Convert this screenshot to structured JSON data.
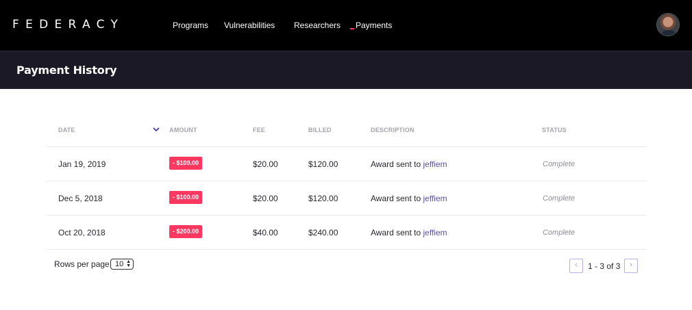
{
  "brand": {
    "logo": "FEDERACY"
  },
  "nav": {
    "items": [
      {
        "label": "Programs"
      },
      {
        "label": "Vulnerabilities"
      },
      {
        "label": "Researchers"
      },
      {
        "label": "Payments"
      }
    ]
  },
  "header": {
    "title": "Payment History"
  },
  "table": {
    "columns": [
      "DATE",
      "AMOUNT",
      "FEE",
      "BILLED",
      "DESCRIPTION",
      "STATUS"
    ],
    "rows": [
      {
        "date": "Jan 19, 2019",
        "amount": "- $100.00",
        "fee": "$20.00",
        "billed": "$120.00",
        "description": "Award sent to",
        "recipient": "jeffiem",
        "status": "Complete"
      },
      {
        "date": "Dec 5, 2018",
        "amount": "- $100.00",
        "fee": "$20.00",
        "billed": "$120.00",
        "description": "Award sent to",
        "recipient": "jeffiem",
        "status": "Complete"
      },
      {
        "date": "Oct 20, 2018",
        "amount": "- $200.00",
        "fee": "$40.00",
        "billed": "$240.00",
        "description": "Award sent to",
        "recipient": "jeffiem",
        "status": "Complete"
      }
    ]
  },
  "pagination": {
    "rows_label": "Rows per page",
    "rows_value": "10",
    "info": "1 - 3 of 3",
    "prev_icon": "chevron-left-icon",
    "next_icon": "chevron-right-icon"
  },
  "colors": {
    "topbar": "#000000",
    "header": "#1b1925",
    "accent": "#ff3860",
    "link": "#5a4fb0"
  }
}
